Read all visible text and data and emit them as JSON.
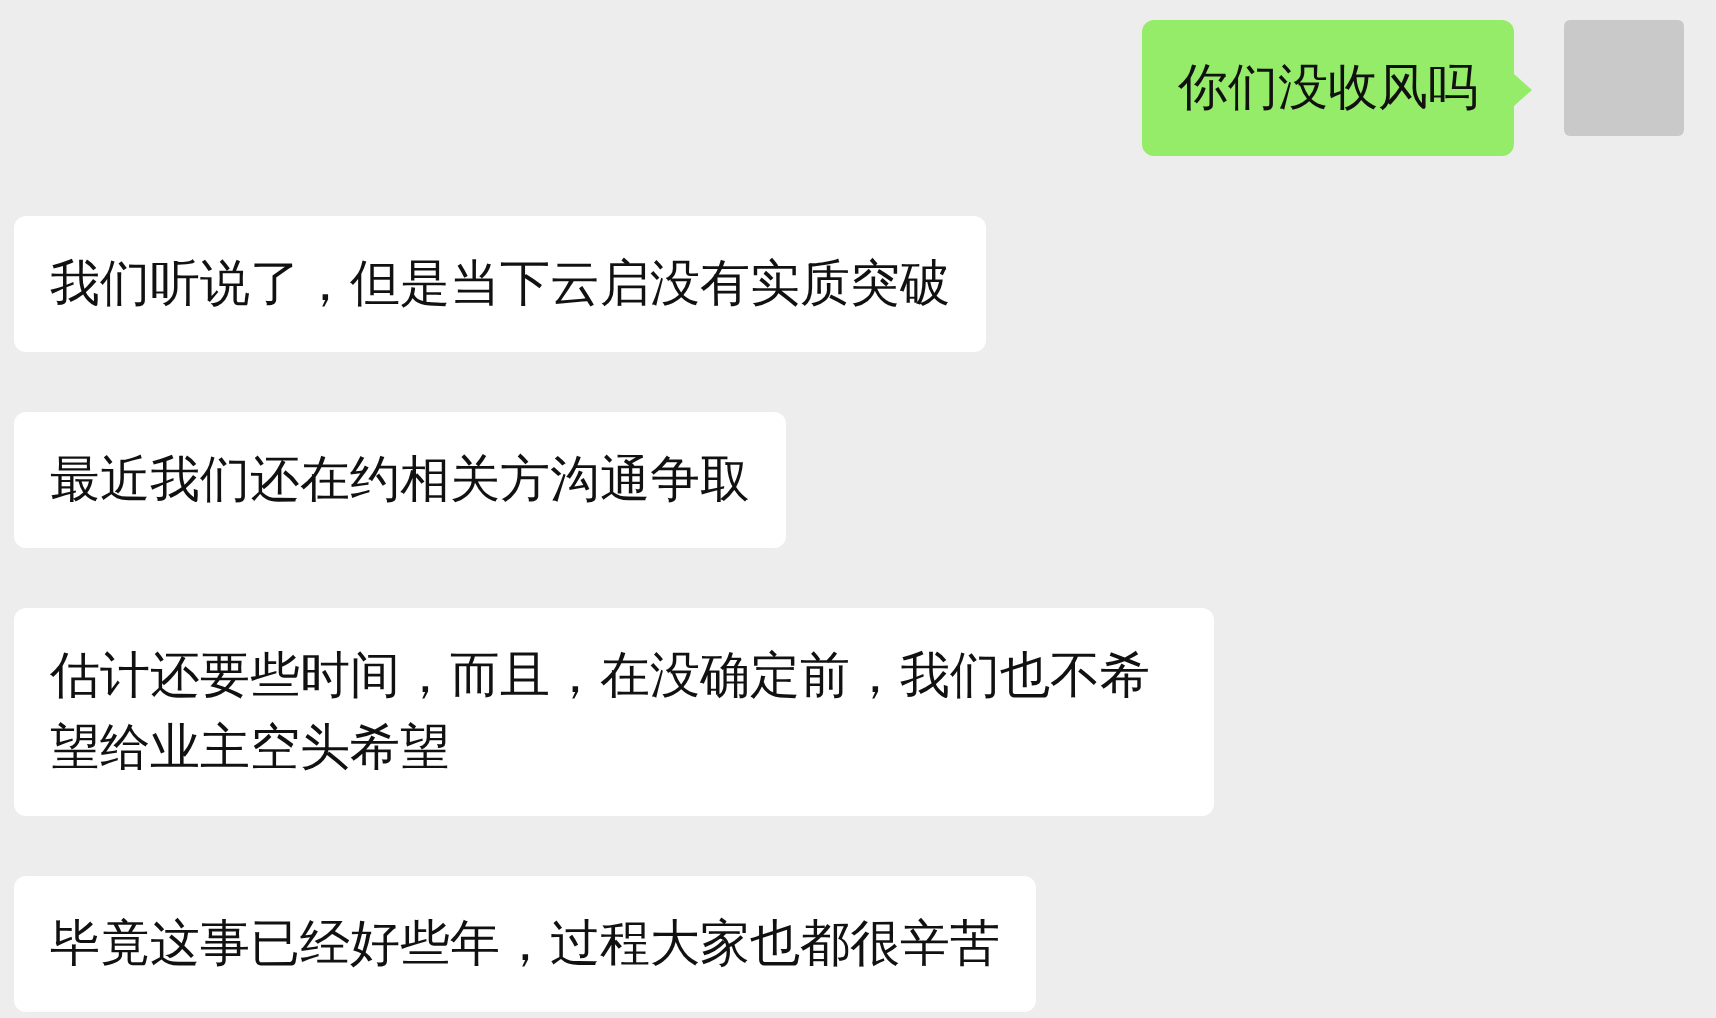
{
  "messages": [
    {
      "kind": "sent",
      "text": "你们没收风吗"
    },
    {
      "kind": "received",
      "text": "我们听说了，但是当下云启没有实质突破"
    },
    {
      "kind": "received",
      "text": "最近我们还在约相关方沟通争取"
    },
    {
      "kind": "received",
      "text": "估计还要些时间，而且，在没确定前，我们也不希望给业主空头希望"
    },
    {
      "kind": "received",
      "text": "毕竟这事已经好些年，过程大家也都很辛苦"
    }
  ]
}
